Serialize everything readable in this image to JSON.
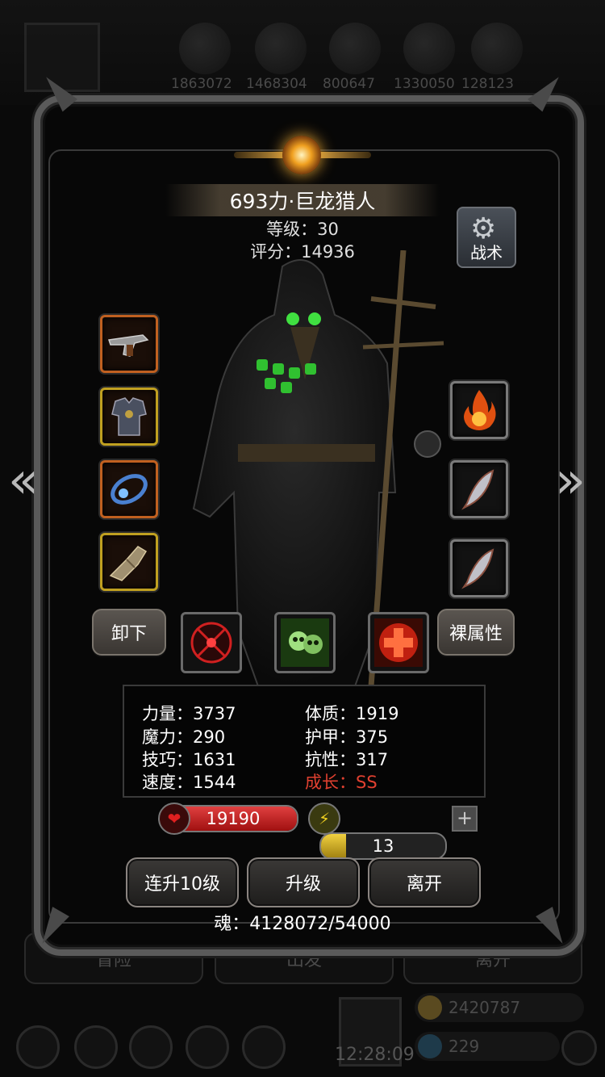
{
  "background": {
    "resources": [
      "1863072",
      "1468304",
      "800647",
      "1330050",
      "128123"
    ],
    "tabs": [
      "冒险",
      "出发",
      "离开"
    ],
    "gold": "2420787",
    "gems": "229",
    "time": "12:28:09"
  },
  "character": {
    "name": "693力·巨龙猎人",
    "level_text": "等级：30",
    "score_text": "评分：14936"
  },
  "tactics_label": "战术",
  "buttons": {
    "unequip": "卸下",
    "base_attr": "裸属性",
    "level_up_10": "连升10级",
    "level_up": "升级",
    "leave": "离开"
  },
  "stats": {
    "strength": "力量：3737",
    "constitution": "体质：1919",
    "magic": "魔力：290",
    "armor": "护甲：375",
    "skill": "技巧：1631",
    "resistance": "抗性：317",
    "speed": "速度：1544",
    "growth": "成长：SS"
  },
  "hp": {
    "value": "19190",
    "fill": 1.0
  },
  "energy": {
    "value": "13",
    "fill": 0.2
  },
  "soul_text": "魂：4128072/54000",
  "colors": {
    "growth": "#e04030",
    "hp": "#c82020",
    "energy": "#e0c020"
  },
  "icons": {
    "left_slots": [
      "pistol-icon",
      "armor-icon",
      "amulet-icon",
      "gauntlet-icon"
    ],
    "right_slots": [
      "fire-icon",
      "feather-icon",
      "feather-icon"
    ],
    "skills": [
      "target-icon",
      "skull-icon",
      "cross-icon"
    ]
  }
}
